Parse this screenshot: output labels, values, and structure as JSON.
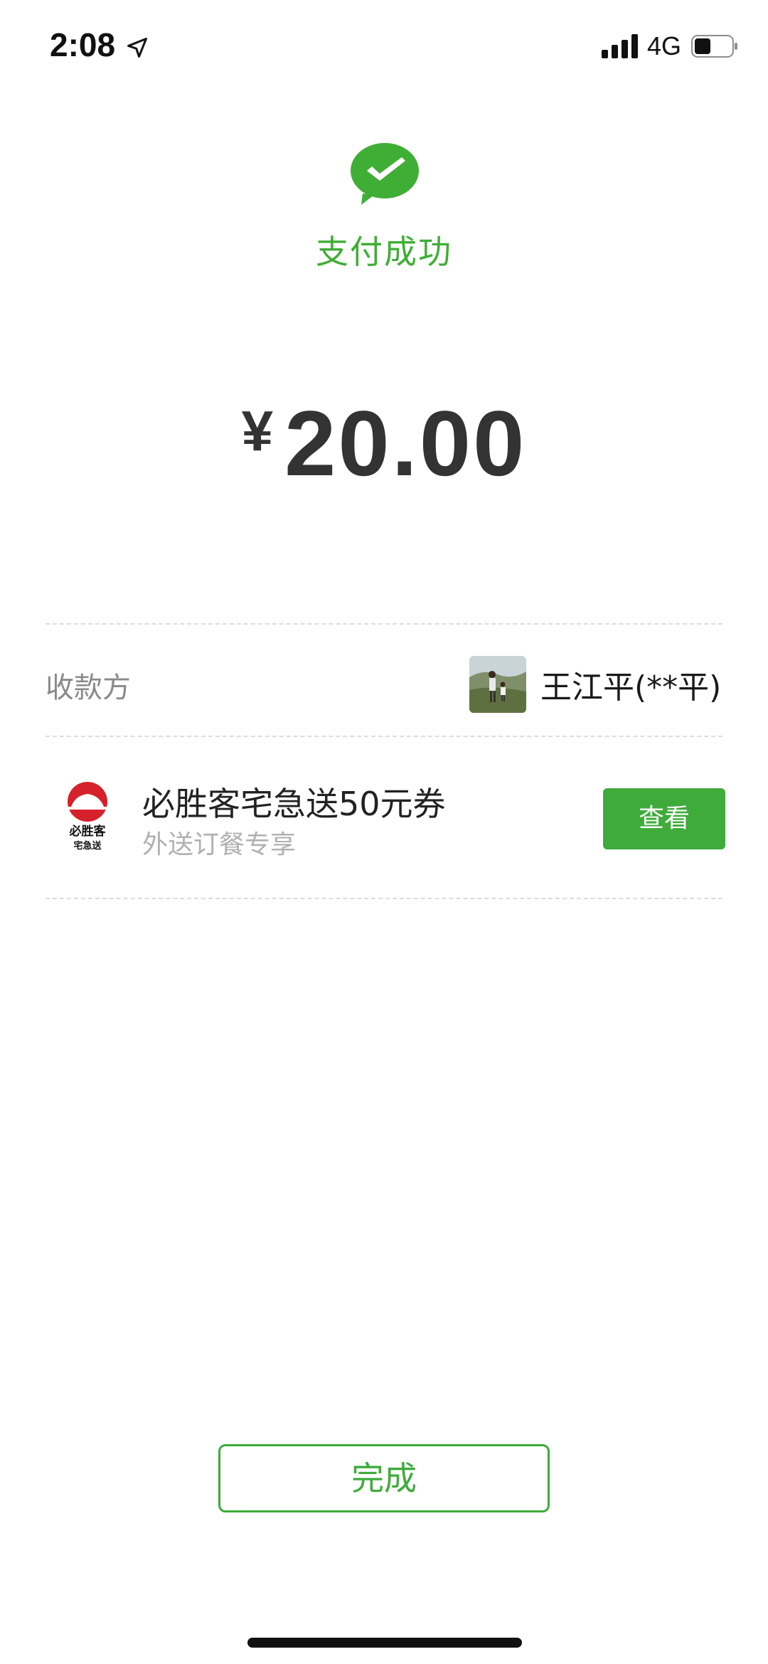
{
  "status_bar": {
    "time": "2:08",
    "network": "4G",
    "icons": [
      "location-arrow-icon",
      "signal-bars-icon",
      "battery-icon"
    ]
  },
  "header": {
    "icon": "wechat-pay-check-icon",
    "title": "支付成功"
  },
  "amount": {
    "currency": "¥",
    "value": "20.00"
  },
  "payee": {
    "label": "收款方",
    "name": "王江平(**平)",
    "avatar": "payee-avatar"
  },
  "coupon": {
    "logo": "pizza-hut-delivery-logo",
    "logo_text_1": "必胜客",
    "logo_text_2": "宅急送",
    "title": "必胜客宅急送50元券",
    "subtitle": "外送订餐专享",
    "button_label": "查看"
  },
  "footer": {
    "done_label": "完成"
  },
  "colors": {
    "brand_green": "#3eab3a",
    "text_primary": "#222222",
    "text_secondary": "#8a8a8a",
    "pizza_red": "#d6202b"
  }
}
